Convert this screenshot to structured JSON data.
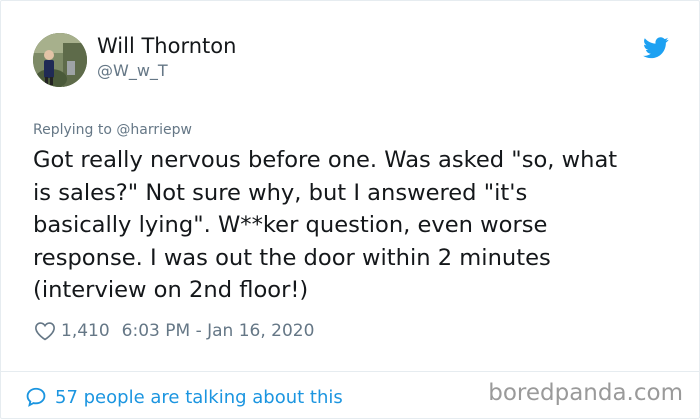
{
  "user": {
    "name": "Will Thornton",
    "handle": "@W_w_T"
  },
  "tweet": {
    "replying_to": "Replying to @harriepw",
    "lines": [
      "Got really nervous before one. Was asked \"so, what",
      "is sales?\" Not sure why, but I answered \"it's",
      "basically lying\". W**ker question, even worse",
      "response. I was out the door within 2 minutes",
      "(interview on 2nd floor!)"
    ],
    "likes": "1,410",
    "timestamp": "6:03 PM - Jan 16, 2020"
  },
  "footer": {
    "talking": "57 people are talking about this",
    "watermark": "boredpanda.com"
  },
  "colors": {
    "text": "#14171a",
    "muted": "#657786",
    "link_blue": "#1b95e0",
    "twitter_blue": "#1da1f2"
  },
  "icons": {
    "brand": "twitter-bird-icon",
    "like": "heart-icon",
    "reply": "speech-bubble-icon"
  }
}
